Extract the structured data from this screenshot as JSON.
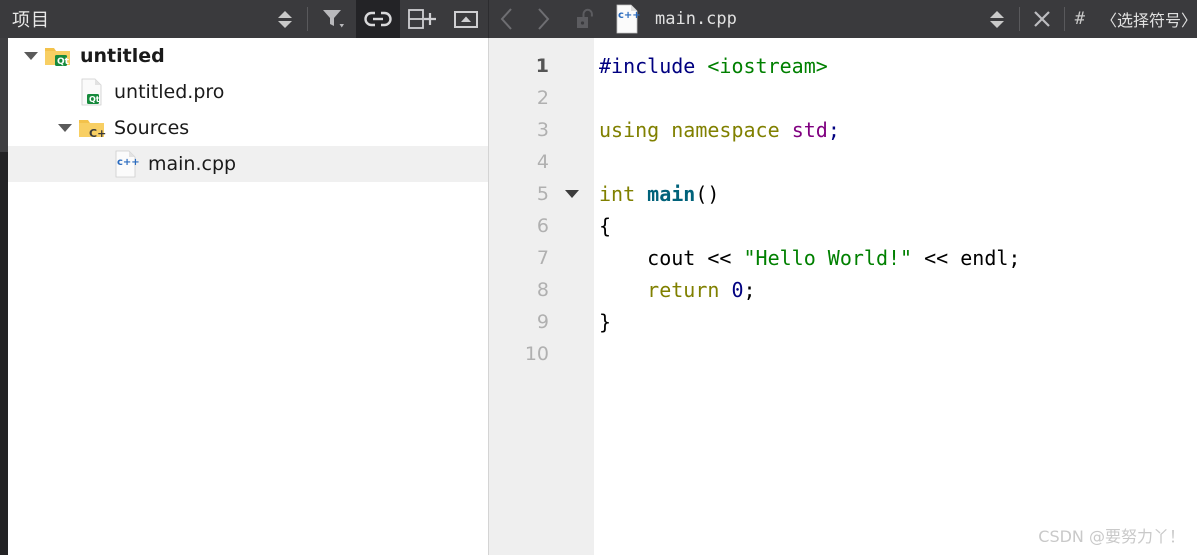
{
  "toolbar": {
    "panel_title": "项目",
    "left_buttons": [
      {
        "name": "sync-updown-button",
        "icon": "up-down-arrows-icon",
        "tooltip": "Synchronize"
      },
      {
        "name": "filter-button",
        "icon": "filter-funnel-icon",
        "tooltip": "Filter Tree"
      },
      {
        "name": "link-with-editor-button",
        "icon": "link-chain-icon",
        "tooltip": "Synchronize with Editor",
        "active": true
      },
      {
        "name": "split-add-button",
        "icon": "split-window-plus-icon",
        "tooltip": "Add Split"
      },
      {
        "name": "collapse-all-button",
        "icon": "collapse-up-icon",
        "tooltip": "Collapse All"
      }
    ],
    "nav_back": "‹",
    "nav_forward": "›",
    "lock_icon": "unlocked-padlock-icon",
    "file_icon": "cpp-file-icon",
    "file_name": "main.cpp",
    "right_updown": "up-down-arrows-icon",
    "close_label": "✕",
    "hash_symbol": "#",
    "symbol_selector": "〈选择符号〉"
  },
  "project_tree": {
    "items": [
      {
        "name": "tree-item-untitled",
        "label": "untitled",
        "icon": "qt-folder-icon",
        "depth": 0,
        "expandable": true,
        "expanded": true,
        "bold": true,
        "selected": false
      },
      {
        "name": "tree-item-untitled-pro",
        "label": "untitled.pro",
        "icon": "qt-pro-file-icon",
        "depth": 1,
        "expandable": false,
        "expanded": false,
        "bold": false,
        "selected": false
      },
      {
        "name": "tree-item-sources",
        "label": "Sources",
        "icon": "cpp-folder-icon",
        "depth": 1,
        "expandable": true,
        "expanded": true,
        "bold": false,
        "selected": false
      },
      {
        "name": "tree-item-main-cpp",
        "label": "main.cpp",
        "icon": "cpp-file-icon",
        "depth": 2,
        "expandable": false,
        "expanded": false,
        "bold": false,
        "selected": true
      }
    ]
  },
  "editor": {
    "current_line": 1,
    "lines": [
      {
        "number": "1",
        "fold": false,
        "tokens": [
          {
            "t": "#include",
            "c": "tok-pre"
          },
          {
            "t": " ",
            "c": "tok-plain"
          },
          {
            "t": "<iostream>",
            "c": "tok-inc"
          }
        ]
      },
      {
        "number": "2",
        "fold": false,
        "tokens": []
      },
      {
        "number": "3",
        "fold": false,
        "tokens": [
          {
            "t": "using",
            "c": "tok-kw"
          },
          {
            "t": " ",
            "c": "tok-plain"
          },
          {
            "t": "namespace",
            "c": "tok-kw"
          },
          {
            "t": " ",
            "c": "tok-plain"
          },
          {
            "t": "std",
            "c": "tok-ns"
          },
          {
            "t": ";",
            "c": "tok-punct"
          }
        ]
      },
      {
        "number": "4",
        "fold": false,
        "tokens": []
      },
      {
        "number": "5",
        "fold": true,
        "tokens": [
          {
            "t": "int",
            "c": "tok-kw"
          },
          {
            "t": " ",
            "c": "tok-plain"
          },
          {
            "t": "main",
            "c": "tok-fn"
          },
          {
            "t": "()",
            "c": "tok-plain"
          }
        ]
      },
      {
        "number": "6",
        "fold": false,
        "tokens": [
          {
            "t": "{",
            "c": "tok-plain"
          }
        ]
      },
      {
        "number": "7",
        "fold": false,
        "tokens": [
          {
            "t": "    cout << ",
            "c": "tok-plain"
          },
          {
            "t": "\"Hello World!\"",
            "c": "tok-str"
          },
          {
            "t": " << endl;",
            "c": "tok-plain"
          }
        ]
      },
      {
        "number": "8",
        "fold": false,
        "tokens": [
          {
            "t": "    ",
            "c": "tok-plain"
          },
          {
            "t": "return",
            "c": "tok-kw"
          },
          {
            "t": " ",
            "c": "tok-plain"
          },
          {
            "t": "0",
            "c": "tok-num"
          },
          {
            "t": ";",
            "c": "tok-plain"
          }
        ]
      },
      {
        "number": "9",
        "fold": false,
        "tokens": [
          {
            "t": "}",
            "c": "tok-plain"
          }
        ]
      },
      {
        "number": "10",
        "fold": false,
        "tokens": []
      }
    ]
  },
  "watermark": "CSDN @要努力丫！",
  "colors": {
    "toolbar_bg": "#3a3a3d",
    "active_btn_bg": "#232326",
    "gutter_bg": "#efefef",
    "selection_bg": "#f0f0f0",
    "editor_bg": "#ffffff",
    "preprocessor": "#000080",
    "include_path": "#008000",
    "keyword": "#808000",
    "namespace": "#800080",
    "function": "#00627a",
    "string": "#008000",
    "number": "#000080"
  }
}
